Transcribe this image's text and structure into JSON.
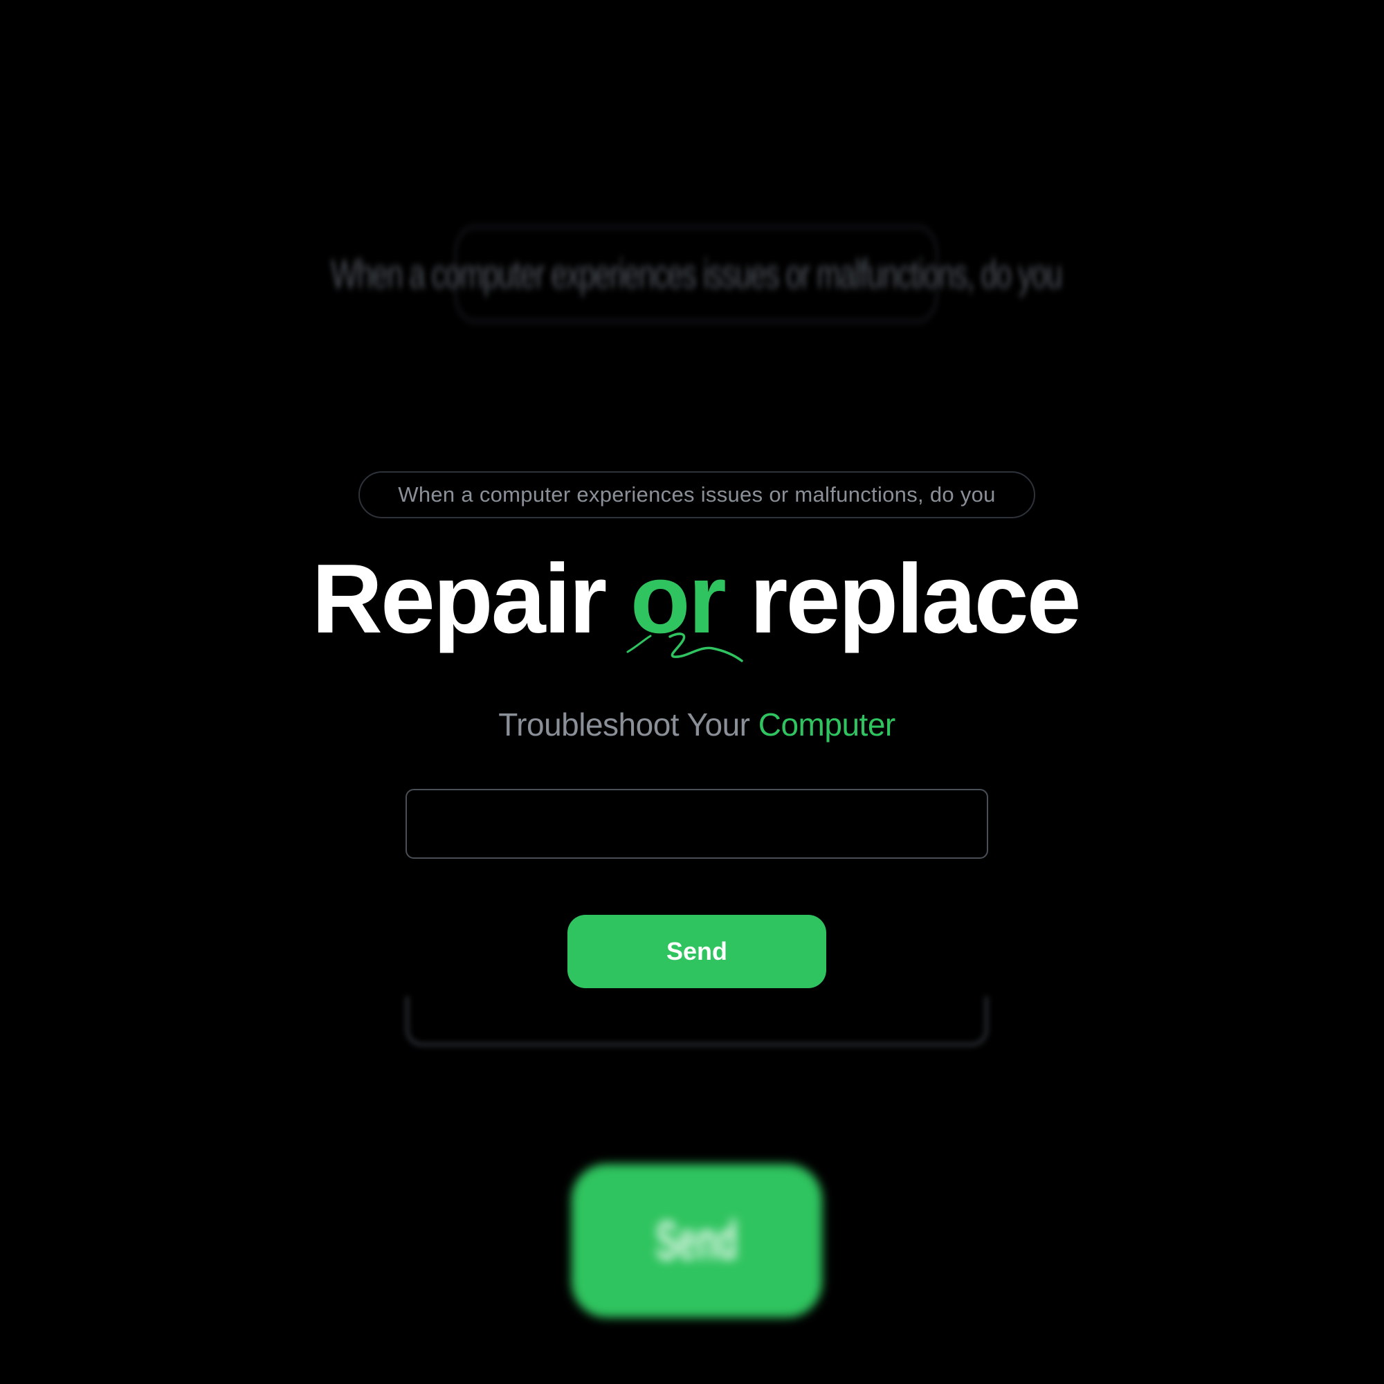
{
  "colors": {
    "background": "#000000",
    "accent": "#2fc45f",
    "muted_text": "#8a8f98",
    "heading_text": "#ffffff"
  },
  "question": {
    "text": "When a computer experiences issues or malfunctions, do you"
  },
  "headline": {
    "word_1": "Repair",
    "word_2": "or",
    "word_3": "replace"
  },
  "subtitle": {
    "prefix": "Troubleshoot Your",
    "highlight": "Computer"
  },
  "issue_input": {
    "value": "",
    "placeholder": ""
  },
  "send_button": {
    "label": "Send"
  },
  "background_echo": {
    "question_text": "When a computer experiences issues or malfunctions, do you",
    "send_label": "Send"
  },
  "icons": {
    "underline_squiggle": "squiggle-underline-icon"
  }
}
